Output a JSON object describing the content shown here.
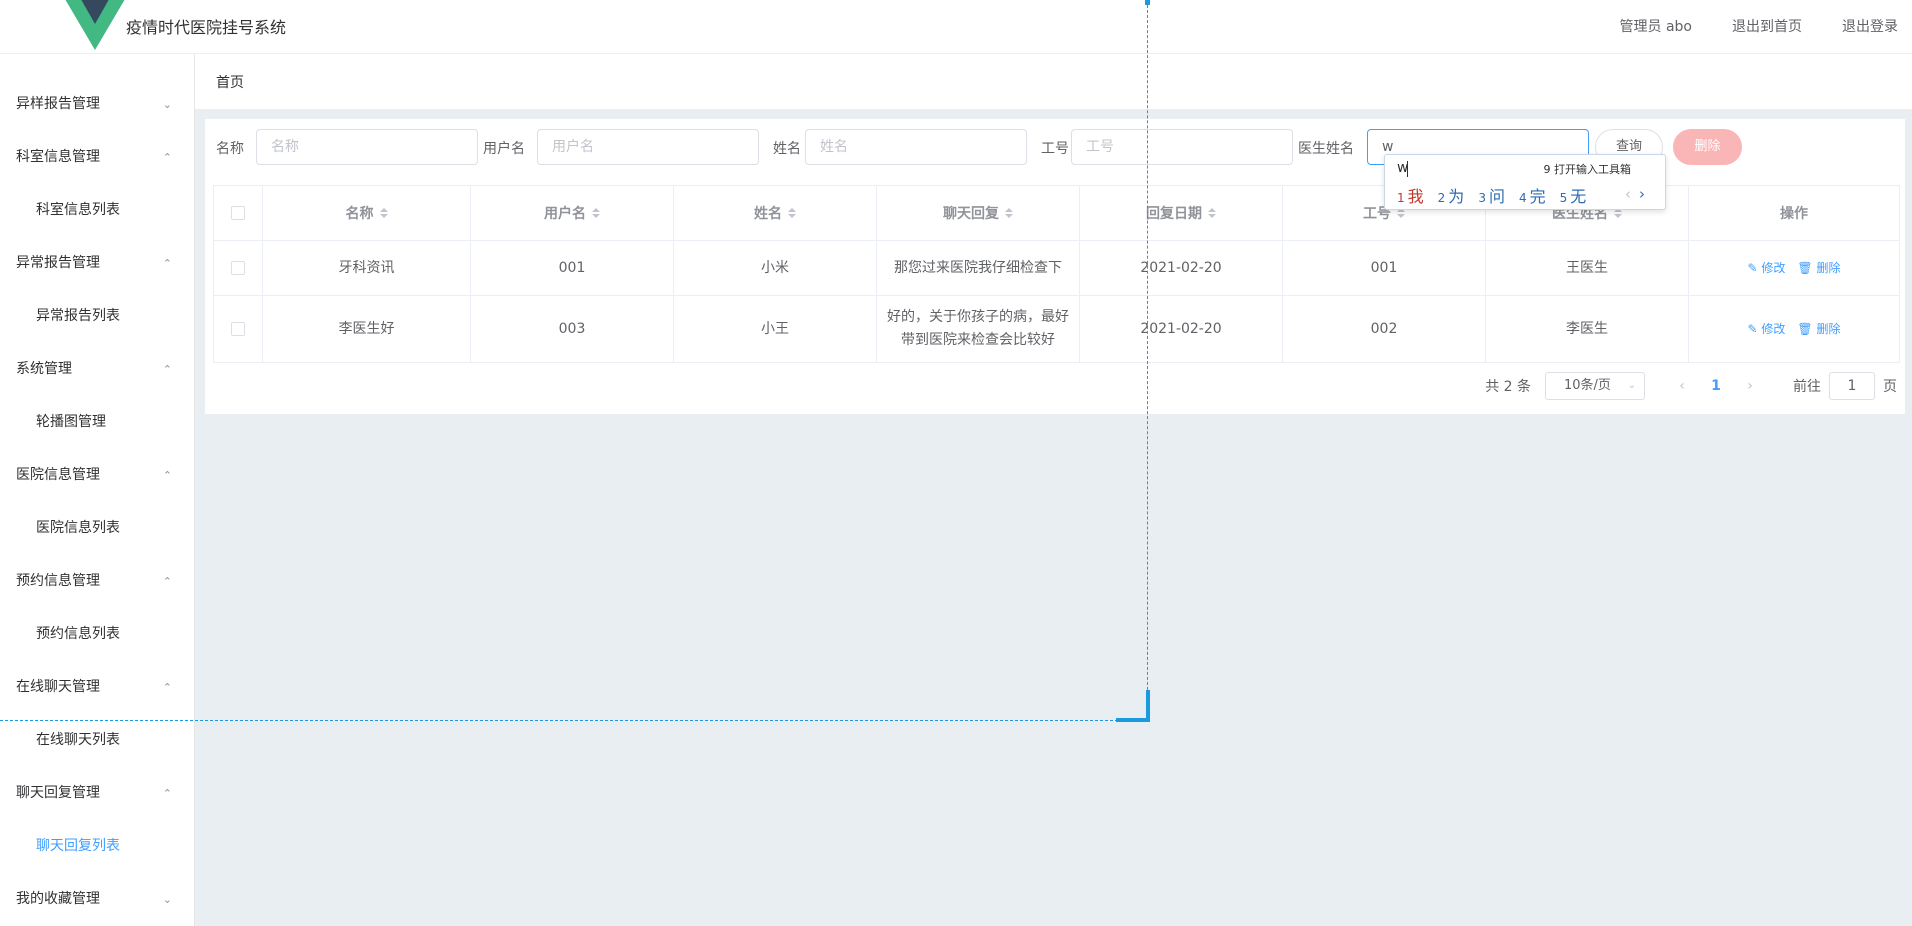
{
  "header": {
    "app_title": "疫情时代医院挂号系统",
    "admin_label": "管理员 abo",
    "back_home": "退出到首页",
    "logout": "退出登录"
  },
  "sidebar": {
    "groups": [
      {
        "label": "异样报告管理",
        "expanded": false
      },
      {
        "label": "科室信息管理",
        "expanded": true,
        "children": [
          "科室信息列表"
        ]
      },
      {
        "label": "异常报告管理",
        "expanded": true,
        "children": [
          "异常报告列表"
        ]
      },
      {
        "label": "系统管理",
        "expanded": true,
        "children": [
          "轮播图管理"
        ]
      },
      {
        "label": "医院信息管理",
        "expanded": true,
        "children": [
          "医院信息列表"
        ]
      },
      {
        "label": "预约信息管理",
        "expanded": true,
        "children": [
          "预约信息列表"
        ]
      },
      {
        "label": "在线聊天管理",
        "expanded": true,
        "children": [
          "在线聊天列表"
        ]
      },
      {
        "label": "聊天回复管理",
        "expanded": true,
        "children": [
          "聊天回复列表"
        ],
        "active_child": "聊天回复列表"
      },
      {
        "label": "我的收藏管理",
        "expanded": false
      }
    ],
    "active_color": "#409EFF"
  },
  "breadcrumb": "首页",
  "search": {
    "fields": [
      {
        "label": "名称",
        "placeholder": "名称",
        "value": ""
      },
      {
        "label": "用户名",
        "placeholder": "用户名",
        "value": ""
      },
      {
        "label": "姓名",
        "placeholder": "姓名",
        "value": ""
      },
      {
        "label": "工号",
        "placeholder": "工号",
        "value": ""
      },
      {
        "label": "医生姓名",
        "placeholder": "医生姓名",
        "value": "w"
      }
    ],
    "query_button": "查询",
    "delete_button": "删除",
    "delete_color": "#fab6b6"
  },
  "table": {
    "columns": [
      "名称",
      "用户名",
      "姓名",
      "聊天回复",
      "回复日期",
      "工号",
      "医生姓名",
      "操作"
    ],
    "rows": [
      {
        "名称": "牙科资讯",
        "用户名": "001",
        "姓名": "小米",
        "聊天回复": "那您过来医院我仔细检查下",
        "回复日期": "2021-02-20",
        "工号": "001",
        "医生姓名": "王医生"
      },
      {
        "名称": "李医生好",
        "用户名": "003",
        "姓名": "小王",
        "聊天回复": "好的，关于你孩子的病，最好带到医院来检查会比较好",
        "回复日期": "2021-02-20",
        "工号": "002",
        "医生姓名": "李医生"
      }
    ],
    "edit_label": "修改",
    "delete_label": "删除"
  },
  "pagination": {
    "total_text": "共 2 条",
    "page_size": "10条/页",
    "current_page": "1",
    "goto_label": "前往",
    "goto_value": "1",
    "page_suffix": "页"
  },
  "ime": {
    "input": "w",
    "toolbox": "9 打开输入工具箱",
    "candidates": [
      {
        "n": "1",
        "text": "我"
      },
      {
        "n": "2",
        "text": "为"
      },
      {
        "n": "3",
        "text": "问"
      },
      {
        "n": "4",
        "text": "完"
      },
      {
        "n": "5",
        "text": "无"
      }
    ]
  },
  "colors": {
    "primary": "#409EFF",
    "logo_green": "#42b883",
    "logo_dark": "#35495e",
    "background": "#e9eef3"
  }
}
